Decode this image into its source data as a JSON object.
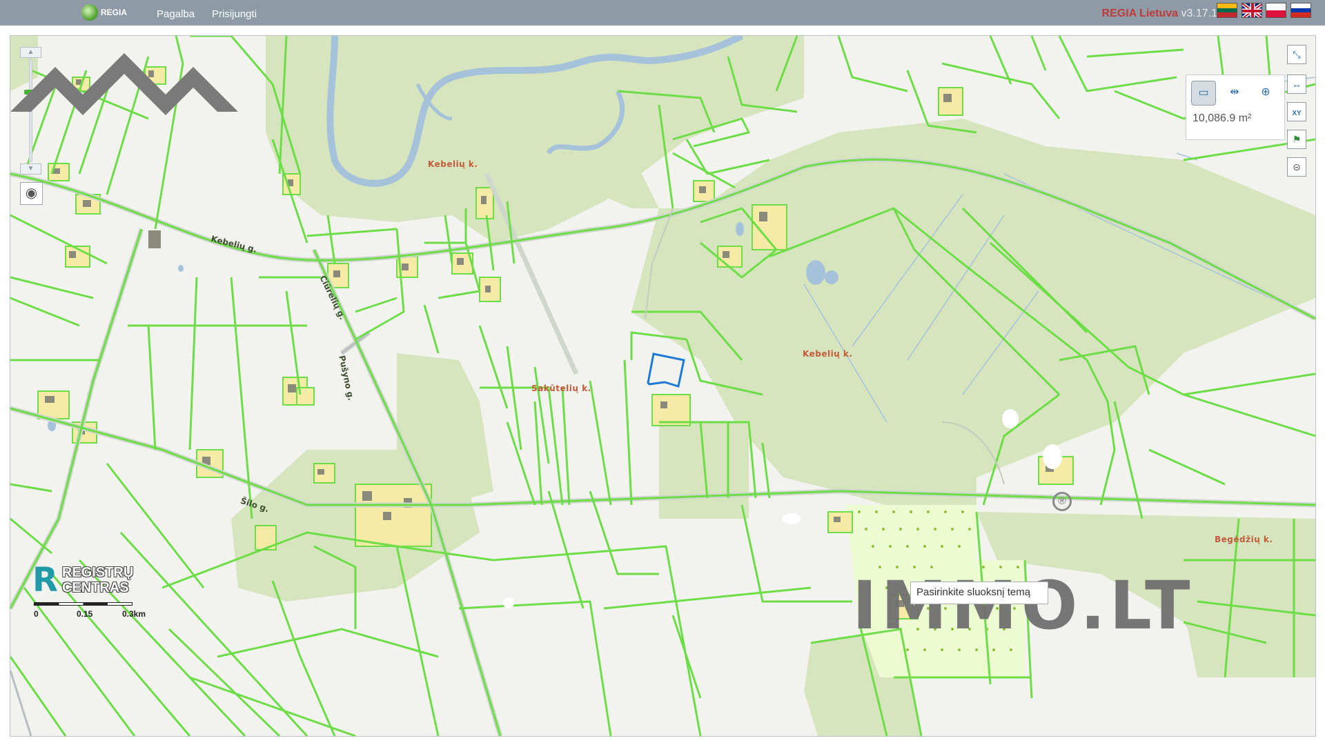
{
  "header": {
    "logo_text": "REGIA",
    "nav": [
      {
        "label": "Pagalba"
      },
      {
        "label": "Prisijungti"
      }
    ],
    "brand": "REGIA Lietuva",
    "version": "v3.17.1",
    "languages": [
      "lt",
      "en",
      "pl",
      "ru"
    ]
  },
  "map": {
    "measure": {
      "value": "10,086.9 m²",
      "active_tool": "area"
    },
    "place_labels": [
      {
        "text": "Kebelių k."
      },
      {
        "text": "Kebelių k."
      },
      {
        "text": "Sakūtelių k."
      },
      {
        "text": "Begėdžių k."
      }
    ],
    "street_labels": [
      {
        "text": "Kebelių g."
      },
      {
        "text": "Ciūrelių g."
      },
      {
        "text": "Pušyno g."
      },
      {
        "text": "Šilo g."
      }
    ],
    "scale": {
      "labels": [
        "0",
        "0.15",
        "0.3km"
      ]
    },
    "layer_search": {
      "placeholder": "Pasirinkite sluoksnį temą"
    },
    "watermark": {
      "brand_text": "REGISTRŲ CENTRAS",
      "immo_text": "IMMO.LT",
      "registered": "®"
    }
  },
  "colors": {
    "parcel": "#6ddd47",
    "forest": "#d6e5bd",
    "selected": "#1d78d6",
    "topbar": "#8e9ba6",
    "brand": "#c03a3a"
  }
}
